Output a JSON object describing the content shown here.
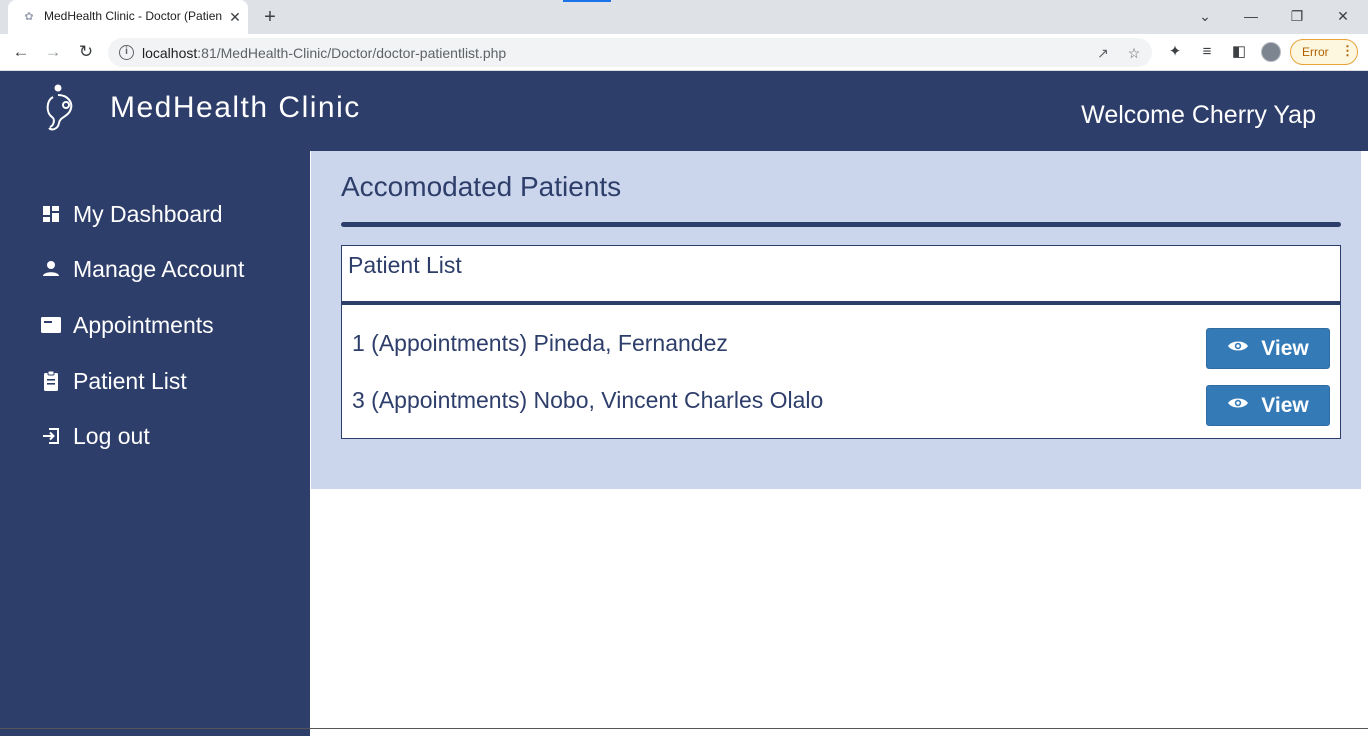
{
  "browser": {
    "tab_title": "MedHealth Clinic - Doctor (Patien",
    "url_host": "localhost",
    "url_path": ":81/MedHealth-Clinic/Doctor/doctor-patientlist.php",
    "error_label": "Error"
  },
  "header": {
    "brand": "MedHealth Clinic",
    "welcome": "Welcome Cherry Yap"
  },
  "sidebar": {
    "items": [
      {
        "label": "My Dashboard",
        "icon": "dashboard-icon"
      },
      {
        "label": "Manage Account",
        "icon": "person-icon"
      },
      {
        "label": "Appointments",
        "icon": "card-icon"
      },
      {
        "label": "Patient List",
        "icon": "clipboard-icon"
      },
      {
        "label": "Log out",
        "icon": "logout-icon"
      }
    ]
  },
  "main": {
    "title": "Accomodated Patients",
    "card_title": "Patient List",
    "patients": [
      {
        "text": "1 (Appointments) Pineda, Fernandez",
        "button": "View"
      },
      {
        "text": "3 (Appointments) Nobo, Vincent Charles Olalo",
        "button": "View"
      }
    ]
  },
  "colors": {
    "brand_navy": "#2e3e6b",
    "panel_bg": "#cbd5ec",
    "button_blue": "#337ab7"
  }
}
